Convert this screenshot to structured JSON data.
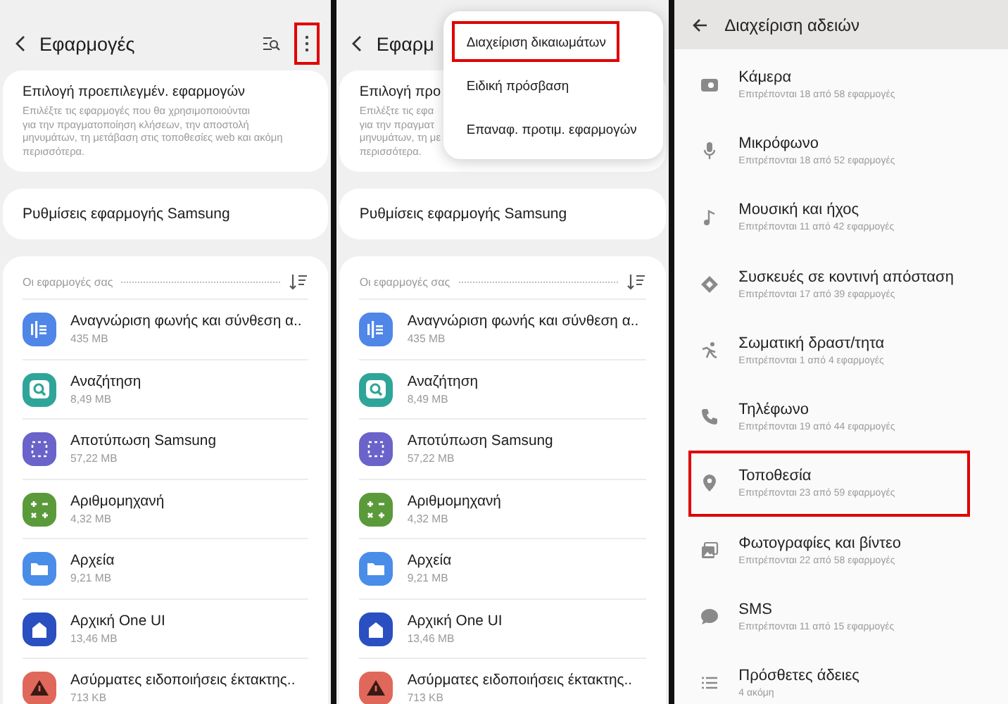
{
  "panels": [
    {
      "kind": "apps",
      "title": "Εφαρμογές",
      "more_highlighted": true,
      "default_apps": {
        "title": "Επιλογή προεπιλεγμέν. εφαρμογών",
        "lines": [
          "Επιλέξτε τις εφαρμογές που θα χρησιμοποιούνται",
          "για την πραγματοποίηση κλήσεων, την αποστολή",
          "μηνυμάτων, τη μετάβαση στις τοποθεσίες web και ακόμη",
          "περισσότερα."
        ]
      },
      "samsung_settings": "Ρυθμίσεις εφαρμογής Samsung",
      "section_label": "Οι εφαρμογές σας",
      "apps": [
        {
          "name": "Αναγνώριση φωνής και σύνθεση α..",
          "size": "435 MB",
          "kind": "voice",
          "color": "#4f86e8"
        },
        {
          "name": "Αναζήτηση",
          "size": "8,49 MB",
          "kind": "search",
          "color": "#2fa59a"
        },
        {
          "name": "Αποτύπωση Samsung",
          "size": "57,22 MB",
          "kind": "capture",
          "color": "#6a63c9"
        },
        {
          "name": "Αριθμομηχανή",
          "size": "4,32 MB",
          "kind": "calculator",
          "color": "#5a9a3a"
        },
        {
          "name": "Αρχεία",
          "size": "9,21 MB",
          "kind": "folder",
          "color": "#4a8de8"
        },
        {
          "name": "Αρχική One UI",
          "size": "13,46 MB",
          "kind": "home",
          "color": "#2a4fc0"
        },
        {
          "name": "Ασύρματες ειδοποιήσεις έκτακτης..",
          "size": "713 KB",
          "kind": "alert",
          "color": "#e0685a"
        }
      ]
    },
    {
      "kind": "apps",
      "title": "Εφαρμ",
      "default_apps": {
        "title": "Επιλογή προ",
        "lines": [
          "Επιλέξτε τις εφα",
          "για την πραγματ",
          "μηνυμάτων, τη με",
          "περισσότερα."
        ]
      },
      "samsung_settings": "Ρυθμίσεις εφαρμογής Samsung",
      "section_label": "Οι εφαρμογές σας",
      "apps": [
        {
          "name": "Αναγνώριση φωνής και σύνθεση α..",
          "size": "435 MB",
          "kind": "voice",
          "color": "#4f86e8"
        },
        {
          "name": "Αναζήτηση",
          "size": "8,49 MB",
          "kind": "search",
          "color": "#2fa59a"
        },
        {
          "name": "Αποτύπωση Samsung",
          "size": "57,22 MB",
          "kind": "capture",
          "color": "#6a63c9"
        },
        {
          "name": "Αριθμομηχανή",
          "size": "4,32 MB",
          "kind": "calculator",
          "color": "#5a9a3a"
        },
        {
          "name": "Αρχεία",
          "size": "9,21 MB",
          "kind": "folder",
          "color": "#4a8de8"
        },
        {
          "name": "Αρχική One UI",
          "size": "13,46 MB",
          "kind": "home",
          "color": "#2a4fc0"
        },
        {
          "name": "Ασύρματες ειδοποιήσεις έκτακτης..",
          "size": "713 KB",
          "kind": "alert",
          "color": "#e0685a"
        }
      ],
      "menu": [
        {
          "label": "Διαχείριση δικαιωμάτων",
          "highlighted": true
        },
        {
          "label": "Ειδική πρόσβαση",
          "highlighted": false
        },
        {
          "label": "Επαναφ. προτιμ. εφαρμογών",
          "highlighted": false
        }
      ]
    },
    {
      "kind": "permissions",
      "title": "Διαχείριση αδειών",
      "items": [
        {
          "name": "Κάμερα",
          "detail": "Επιτρέπονται 18 από 58 εφαρμογές",
          "kind": "camera",
          "highlighted": false
        },
        {
          "name": "Μικρόφωνο",
          "detail": "Επιτρέπονται 18 από 52 εφαρμογές",
          "kind": "mic",
          "highlighted": false
        },
        {
          "name": "Μουσική και ήχος",
          "detail": "Επιτρέπονται 11 από 42 εφαρμογές",
          "kind": "music",
          "highlighted": false
        },
        {
          "name": "Συσκευές σε κοντινή απόσταση",
          "detail": "Επιτρέπονται 17 από 39 εφαρμογές",
          "kind": "nearby",
          "highlighted": false
        },
        {
          "name": "Σωματική δραστ/τητα",
          "detail": "Επιτρέπονται 1 από 4 εφαρμογές",
          "kind": "activity",
          "highlighted": false
        },
        {
          "name": "Τηλέφωνο",
          "detail": "Επιτρέπονται 19 από 44 εφαρμογές",
          "kind": "phone",
          "highlighted": false
        },
        {
          "name": "Τοποθεσία",
          "detail": "Επιτρέπονται 23 από 59 εφαρμογές",
          "kind": "location",
          "highlighted": true
        },
        {
          "name": "Φωτογραφίες και βίντεο",
          "detail": "Επιτρέπονται 22 από 58 εφαρμογές",
          "kind": "photos",
          "highlighted": false
        },
        {
          "name": "SMS",
          "detail": "Επιτρέπονται 11 από 15 εφαρμογές",
          "kind": "sms",
          "highlighted": false
        },
        {
          "name": "Πρόσθετες άδειες",
          "detail": "4 ακόμη",
          "kind": "list",
          "highlighted": false
        }
      ]
    }
  ]
}
